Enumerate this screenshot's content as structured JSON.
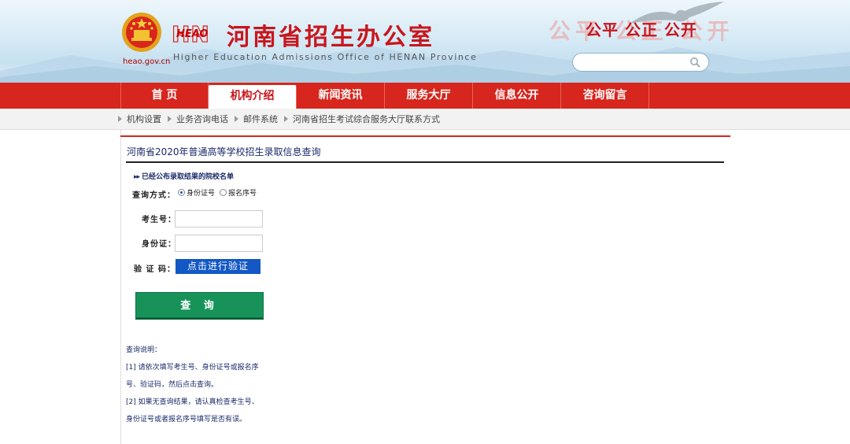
{
  "header": {
    "domain": "heao.gov.cn",
    "hn_letters": "HN",
    "heao": "HEAO",
    "title": "河南省招生办公室",
    "subtitle": "Higher Education Admissions Office of HENAN Province",
    "slogan_shadow": "公平 公正 公开",
    "slogan": "公平 公正 公开"
  },
  "nav": {
    "items": [
      "首 页",
      "机构介绍",
      "新闻资讯",
      "服务大厅",
      "信息公开",
      "咨询留言"
    ],
    "active_index": 1
  },
  "subnav": {
    "items": [
      "机构设置",
      "业务咨询电话",
      "邮件系统",
      "河南省招生考试综合服务大厅联系方式"
    ]
  },
  "main": {
    "heading": "河南省2020年普通高等学校招生录取信息查询",
    "notice_mark": "▸▸",
    "notice_link": "已经公布录取结果的院校名单",
    "form": {
      "mode_label": "查询方式：",
      "mode_options": [
        "身份证号",
        "报名序号"
      ],
      "mode_selected": "身份证号",
      "exam_no_label": "考生号：",
      "exam_no_value": "",
      "id_label": "身份证：",
      "id_value": "",
      "captcha_label": "验 证 码：",
      "captcha_button": "点击进行验证",
      "submit": "查 询"
    },
    "notes": {
      "title": "查询说明：",
      "lines": [
        "[1] 请依次填写考生号、身份证号或报名序",
        "号、验证码，然后点击查询。",
        "[2] 如果无查询结果，请认真检查考生号、",
        "身份证号或者报名序号填写是否有误。"
      ]
    }
  },
  "colors": {
    "brand_red": "#d6261d",
    "heading_navy": "#1a2a6a",
    "verify_blue": "#1358c4",
    "submit_green": "#17935a"
  }
}
